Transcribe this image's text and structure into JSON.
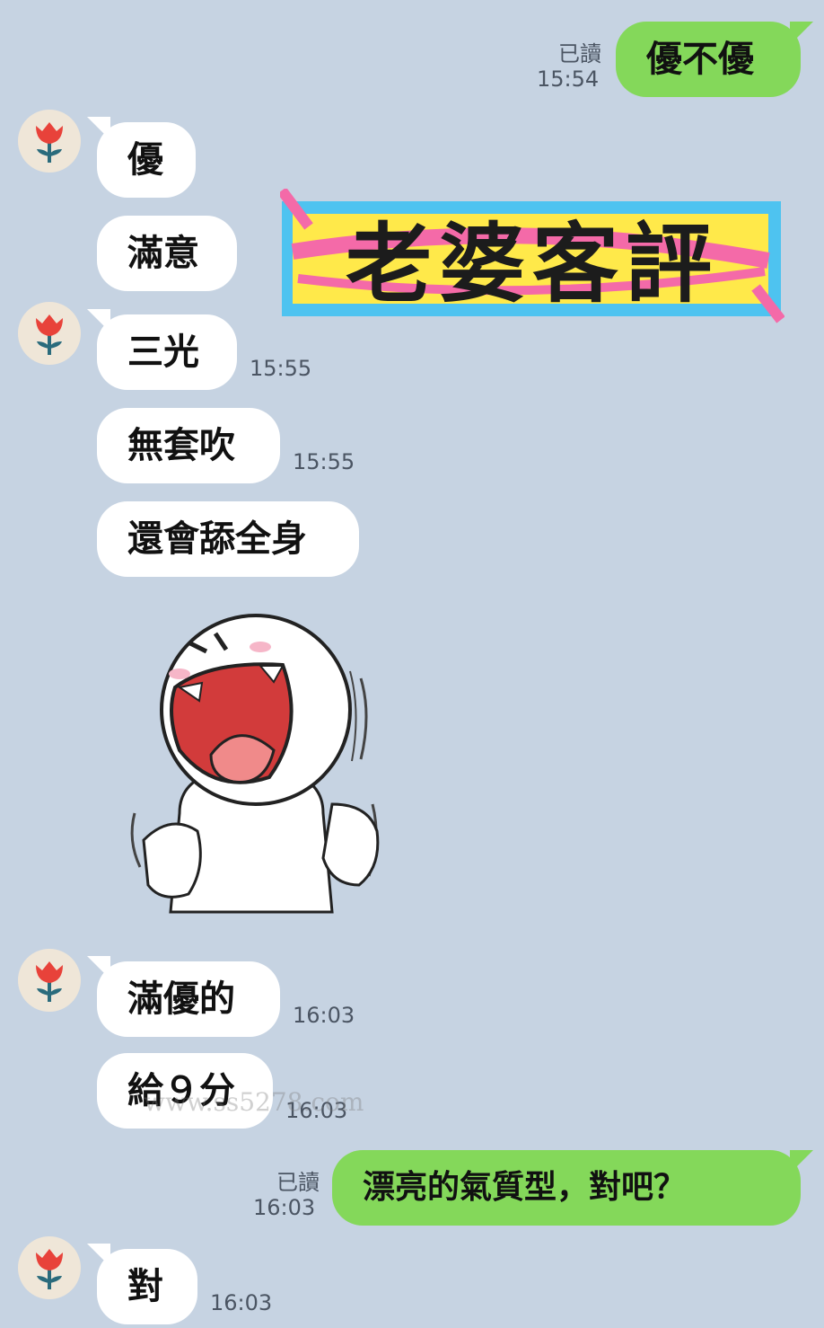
{
  "chat": {
    "messages": [
      {
        "sender": "me",
        "text": "優不優",
        "read": "已讀",
        "time": "15:54"
      },
      {
        "sender": "them",
        "text": "優",
        "time": ""
      },
      {
        "sender": "them",
        "text": "滿意",
        "time": ""
      },
      {
        "sender": "them",
        "text": "三光",
        "time": "15:55"
      },
      {
        "sender": "them",
        "text": "無套吹",
        "time": "15:55"
      },
      {
        "sender": "them",
        "text": "還會舔全身",
        "time": ""
      },
      {
        "sender": "them",
        "type": "sticker",
        "sticker": "laughing-face-sticker"
      },
      {
        "sender": "them",
        "text": "滿優的",
        "time": "16:03"
      },
      {
        "sender": "them",
        "text": "給９分",
        "time": "16:03"
      },
      {
        "sender": "me",
        "text": "漂亮的氣質型，對吧？",
        "read": "已讀",
        "time": "16:03"
      },
      {
        "sender": "them",
        "text": "對",
        "time": "16:03"
      }
    ]
  },
  "overlay": {
    "title": "老婆客評",
    "watermark": "www.ss5278.com"
  },
  "colors": {
    "background": "#c6d3e2",
    "incoming_bubble": "#ffffff",
    "outgoing_bubble": "#84d85a",
    "banner_blue": "#4ec3f0",
    "banner_yellow": "#ffe94a",
    "banner_pink": "#f46aa8"
  },
  "icons": {
    "avatar": "red-flower-avatar-icon"
  }
}
